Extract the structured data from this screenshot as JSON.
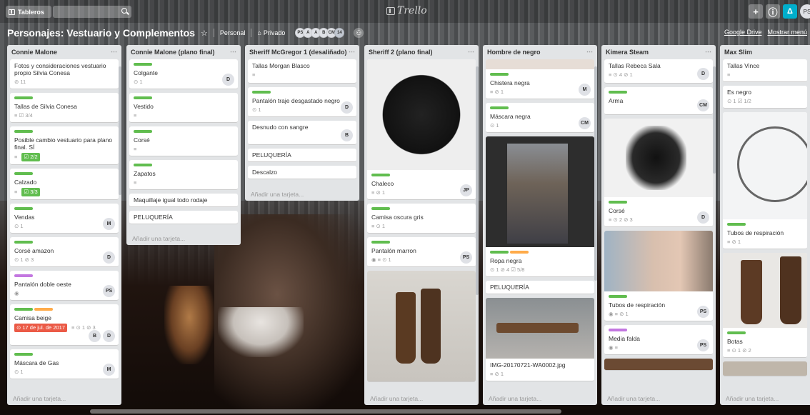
{
  "topbar": {
    "boards_label": "Tableros",
    "logo": "Trello",
    "user_initials": "PS",
    "notif_label": "Δ"
  },
  "board": {
    "title": "Personajes: Vestuario y Complementos",
    "visibility_team": "Personal",
    "visibility": "Privado",
    "members": [
      "PS",
      "A",
      "A",
      "B",
      "CM",
      "14"
    ],
    "google_drive": "Google Drive",
    "show_menu": "Mostrar menú"
  },
  "common": {
    "add_card": "Añadir una tarjeta..."
  },
  "lists": [
    {
      "title": "Connie Malone",
      "cards": [
        {
          "title": "Fotos y consideraciones vestuario propio Silvia Conesa",
          "badges": "⊘ 11"
        },
        {
          "title": "Tallas de Silvia Conesa",
          "badges": "≡  ☑ 3/4"
        },
        {
          "title": "Posible cambio vestuario para plano final. SÍ",
          "badge_check": "☑ 2/2"
        },
        {
          "title": "Calzado",
          "badge_check": "☑ 3/3"
        },
        {
          "title": "Vendas",
          "badges": "⊙ 1",
          "avatar": "M"
        },
        {
          "title": "Corsé amazon",
          "badges": "⊙ 1  ⊘ 3",
          "avatar": "D"
        },
        {
          "title": "Pantalón doble oeste",
          "badges": "◉",
          "avatar": "PS"
        },
        {
          "title": "Camisa beige",
          "due": "⊙ 17 de jul. de 2017",
          "badges": "≡ ⊙ 1  ⊘ 3",
          "avatar": "D",
          "avatar2": "B"
        },
        {
          "title": "Máscara de Gas",
          "badges": "⊙ 1",
          "avatar": "M"
        }
      ]
    },
    {
      "title": "Connie Malone (plano final)",
      "cards": [
        {
          "title": "Colgante",
          "badges": "⊙ 1",
          "avatar": "D"
        },
        {
          "title": "Vestido",
          "badges": "≡"
        },
        {
          "title": "Corsé",
          "badges": "≡"
        },
        {
          "title": "Zapatos",
          "badges": "≡"
        },
        {
          "title": "Maquillaje igual todo rodaje"
        },
        {
          "title": "PELUQUERÍA"
        }
      ]
    },
    {
      "title": "Sheriff McGregor 1 (desaliñado)",
      "cards": [
        {
          "title": "Tallas Morgan Blasco",
          "badges": "≡"
        },
        {
          "title": "Pantalón traje desgastado negro",
          "badges": "⊙ 1",
          "avatar": "D"
        },
        {
          "title": "Desnudo con sangre",
          "avatar": "B"
        },
        {
          "title": "PELUQUERÍA"
        },
        {
          "title": "Descalzo"
        }
      ]
    },
    {
      "title": "Sheriff 2 (plano final)",
      "cards": [
        {
          "title": "Chaleco",
          "badges": "≡  ⊘ 1",
          "avatar": "JP"
        },
        {
          "title": "Camisa oscura gris",
          "badges": "≡  ⊙ 1"
        },
        {
          "title": "Pantalón marron",
          "badges": "◉  ≡  ⊙ 1",
          "avatar": "PS"
        }
      ]
    },
    {
      "title": "Hombre de negro",
      "cards": [
        {
          "title": "Chistera negra",
          "badges": "≡  ⊘ 1",
          "avatar": "M"
        },
        {
          "title": "Máscara negra",
          "badges": "⊙ 1",
          "avatar": "CM"
        },
        {
          "title": "Ropa negra",
          "badges": "⊙ 1  ⊘ 4  ☑ 5/8"
        },
        {
          "title": "PELUQUERÍA"
        },
        {
          "title": "IMG-20170721-WA0002.jpg",
          "badges": "≡  ⊘ 1"
        }
      ]
    },
    {
      "title": "Kimera Steam",
      "cards": [
        {
          "title": "Tallas Rebeca Sala",
          "badges": "≡  ⊙ 4  ⊘ 1",
          "avatar": "D"
        },
        {
          "title": "Arma",
          "avatar": "CM"
        },
        {
          "title": "Corsé",
          "badges": "≡  ⊙ 2  ⊘ 3",
          "avatar": "D"
        },
        {
          "title": "Tubos de respiración",
          "badges": "◉  ≡  ⊘ 1",
          "avatar": "PS"
        },
        {
          "title": "Media falda",
          "badges": "◉  ≡",
          "avatar": "PS"
        }
      ]
    },
    {
      "title": "Max Slim",
      "cards": [
        {
          "title": "Tallas Vince",
          "badges": "≡"
        },
        {
          "title": "Es negro",
          "badges": "⊙ 1  ☑ 1/2"
        },
        {
          "title": "Tubos de respiración",
          "badges": "≡  ⊘ 1"
        },
        {
          "title": "Botas",
          "badges": "≡  ⊙ 1  ⊘ 2"
        }
      ]
    }
  ]
}
